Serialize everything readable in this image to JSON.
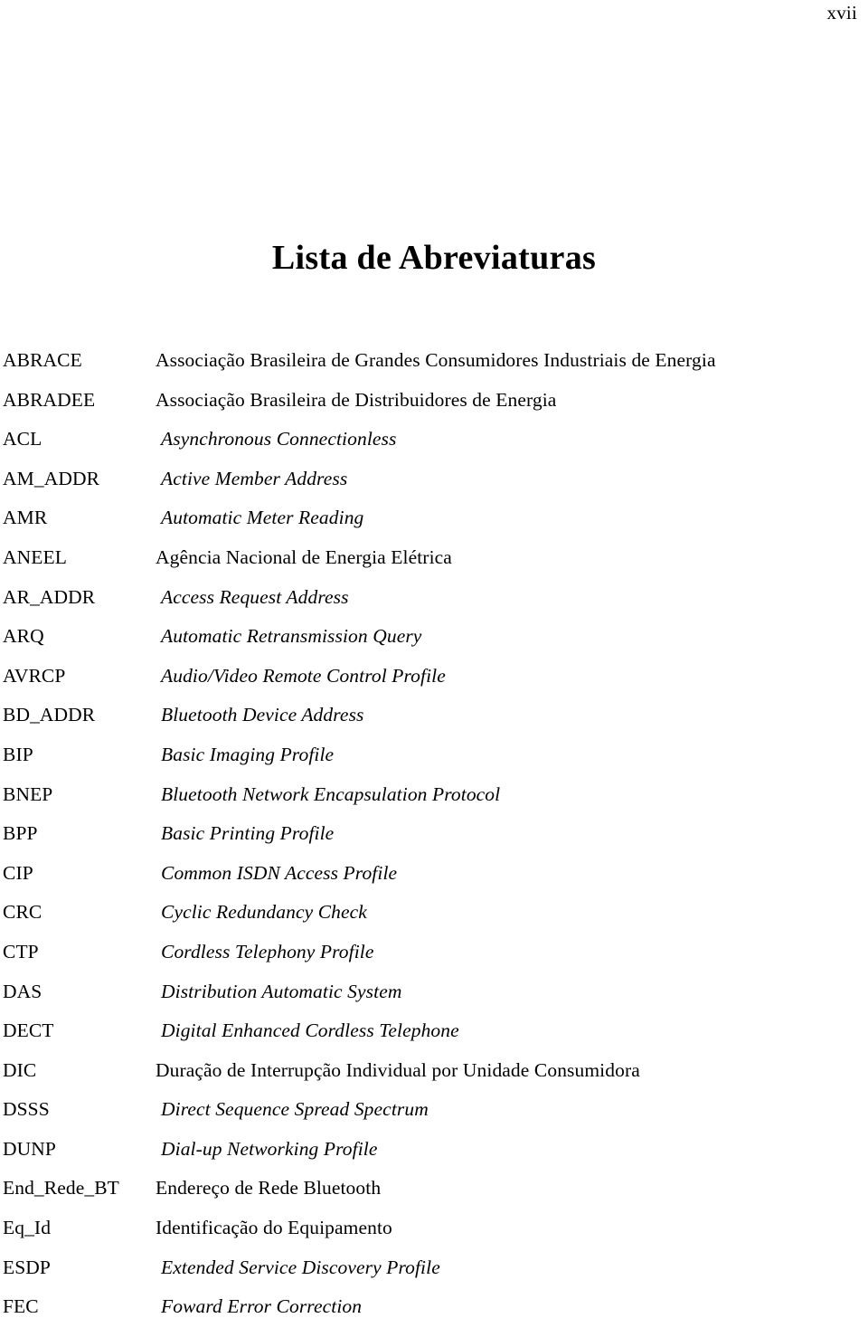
{
  "page": {
    "folio": "xvii",
    "title": "Lista de Abreviaturas"
  },
  "abbreviations": [
    {
      "term": "ABRACE",
      "definition": "Associação Brasileira de Grandes Consumidores Industriais de Energia",
      "lang": "pt"
    },
    {
      "term": "ABRADEE",
      "definition": "Associação Brasileira de Distribuidores de Energia",
      "lang": "pt"
    },
    {
      "term": "ACL",
      "definition": "Asynchronous Connectionless",
      "lang": "en"
    },
    {
      "term": "AM_ADDR",
      "definition": "Active Member Address",
      "lang": "en"
    },
    {
      "term": "AMR",
      "definition": "Automatic Meter Reading",
      "lang": "en"
    },
    {
      "term": "ANEEL",
      "definition": "Agência Nacional de Energia Elétrica",
      "lang": "pt"
    },
    {
      "term": "AR_ADDR",
      "definition": "Access Request Address",
      "lang": "en"
    },
    {
      "term": "ARQ",
      "definition": "Automatic Retransmission Query",
      "lang": "en"
    },
    {
      "term": "AVRCP",
      "definition": "Audio/Video Remote Control Profile",
      "lang": "en"
    },
    {
      "term": "BD_ADDR",
      "definition": "Bluetooth Device Address",
      "lang": "en"
    },
    {
      "term": "BIP",
      "definition": "Basic Imaging Profile",
      "lang": "en"
    },
    {
      "term": "BNEP",
      "definition": "Bluetooth Network Encapsulation Protocol",
      "lang": "en"
    },
    {
      "term": "BPP",
      "definition": "Basic Printing Profile",
      "lang": "en"
    },
    {
      "term": "CIP",
      "definition": "Common ISDN Access Profile",
      "lang": "en"
    },
    {
      "term": "CRC",
      "definition": "Cyclic Redundancy Check",
      "lang": "en"
    },
    {
      "term": "CTP",
      "definition": "Cordless Telephony Profile",
      "lang": "en"
    },
    {
      "term": "DAS",
      "definition": "Distribution Automatic System",
      "lang": "en"
    },
    {
      "term": "DECT",
      "definition": "Digital Enhanced Cordless Telephone",
      "lang": "en"
    },
    {
      "term": "DIC",
      "definition": "Duração de Interrupção Individual por Unidade Consumidora",
      "lang": "pt"
    },
    {
      "term": "DSSS",
      "definition": "Direct Sequence Spread Spectrum",
      "lang": "en"
    },
    {
      "term": "DUNP",
      "definition": "Dial-up Networking Profile",
      "lang": "en"
    },
    {
      "term": "End_Rede_BT",
      "definition": "Endereço de Rede Bluetooth",
      "lang": "pt"
    },
    {
      "term": "Eq_Id",
      "definition": "Identificação do Equipamento",
      "lang": "pt"
    },
    {
      "term": "ESDP",
      "definition": "Extended Service Discovery Profile",
      "lang": "en"
    },
    {
      "term": "FEC",
      "definition": "Foward Error Correction",
      "lang": "en"
    }
  ]
}
